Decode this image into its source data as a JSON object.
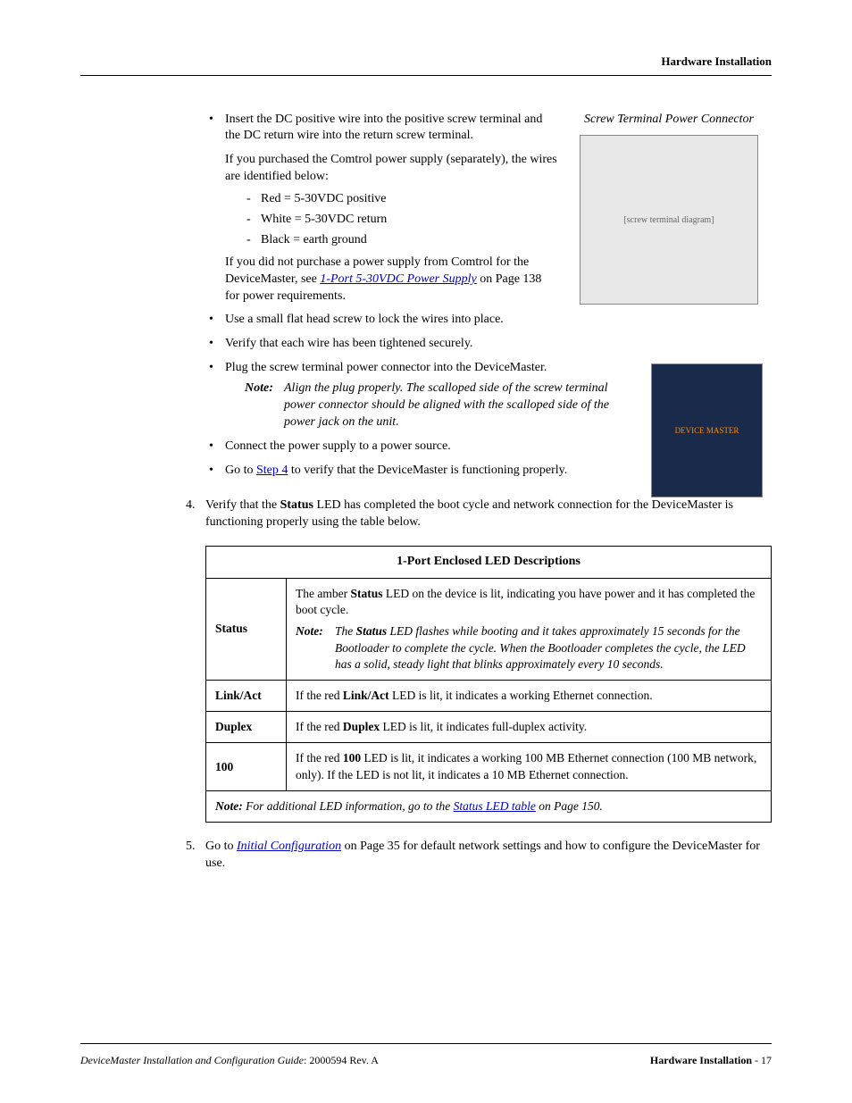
{
  "header": {
    "section": "Hardware Installation"
  },
  "fig1": {
    "caption": "Screw Terminal Power Connector",
    "alt": "[screw terminal diagram]"
  },
  "fig2": {
    "alt": "DEVICE MASTER"
  },
  "b1": {
    "intro": "Insert the DC positive wire into the positive screw terminal and the DC return wire into the return screw terminal.",
    "p2": "If you purchased the Comtrol power supply (separately), the wires are identified below:",
    "d1": "Red = 5-30VDC positive",
    "d2": "White = 5-30VDC return",
    "d3": "Black = earth ground",
    "p3a": "If you did not purchase a power supply from Comtrol for the DeviceMaster, see ",
    "p3link": "1-Port 5-30VDC Power Supply",
    "p3b": " on Page 138 for power requirements."
  },
  "b2": "Use a small flat head screw to lock the wires into place.",
  "b3": "Verify that each wire has been tightened securely.",
  "b4": {
    "t": "Plug the screw terminal power connector into the DeviceMaster.",
    "noteLabel": "Note:",
    "noteBody": "Align the plug properly. The scalloped side of the screw terminal power connector should be aligned with the scalloped side of the power jack on the unit."
  },
  "b5": "Connect the power supply to a power source.",
  "b6": {
    "a": "Go to ",
    "link": "Step 4",
    "b": " to verify that the DeviceMaster is functioning properly."
  },
  "step4": {
    "num": "4.",
    "a": "Verify that the ",
    "bold": "Status",
    "b": " LED has completed the boot cycle and network connection for the DeviceMaster is functioning properly using the table below."
  },
  "table": {
    "title": "1-Port Enclosed LED Descriptions",
    "rows": {
      "status": {
        "label": "Status",
        "p1a": "The amber ",
        "p1bold": "Status",
        "p1b": " LED on the device is lit, indicating you have power and it has completed the boot cycle.",
        "noteLabel": "Note:",
        "noteA": "The ",
        "noteBold": "Status",
        "noteB": " LED flashes while booting and it takes approximately 15 seconds for the Bootloader to complete the cycle. When the Bootloader completes the cycle, the LED has a solid, steady light that blinks approximately every 10 seconds."
      },
      "linkact": {
        "label": "Link/Act",
        "a": "If the red ",
        "bold": "Link/Act",
        "b": " LED is lit, it indicates a working Ethernet connection."
      },
      "duplex": {
        "label": "Duplex",
        "a": "If the red ",
        "bold": "Duplex",
        "b": " LED is lit, it indicates full-duplex activity."
      },
      "h100": {
        "label": "100",
        "a": "If the red ",
        "bold": "100",
        "b": " LED is lit, it indicates a working 100 MB Ethernet connection (100 MB network, only). If the LED is not lit, it indicates a 10 MB Ethernet connection."
      },
      "foot": {
        "noteLabel": "Note:",
        "a": " For additional LED information, go to the ",
        "link": "Status LED table",
        "b": " on Page 150."
      }
    }
  },
  "step5": {
    "num": "5.",
    "a": "Go to ",
    "link": "Initial Configuration",
    "b": " on Page 35 for default network settings and how to configure the DeviceMaster for use."
  },
  "footer": {
    "left": "DeviceMaster Installation and Configuration Guide",
    "leftRev": ": 2000594 Rev. A",
    "rightLabel": "Hardware Installation",
    "rightPage": "  - 17"
  }
}
